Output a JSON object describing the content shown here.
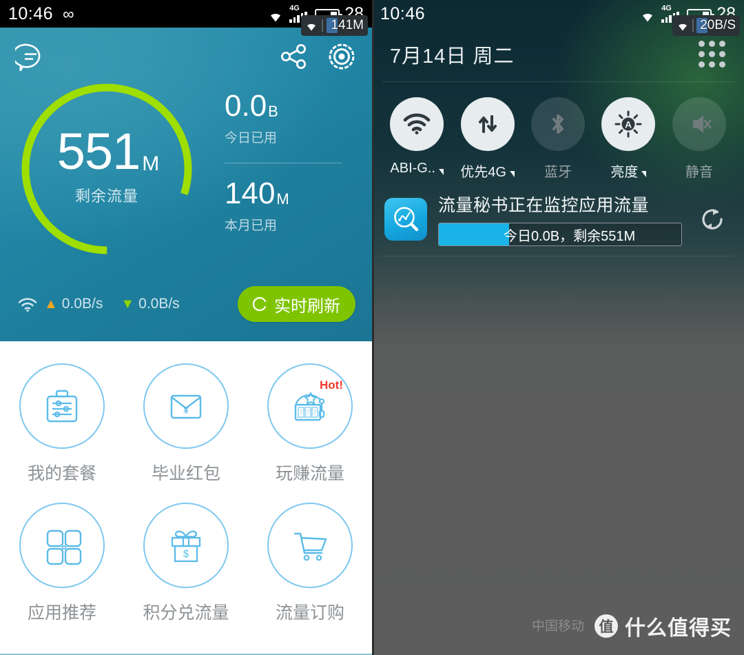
{
  "left": {
    "status_bar": {
      "time": "10:46",
      "infinity_glyph": "∞",
      "battery_percent": "28",
      "network_type": "4G",
      "overlay_badge": {
        "value": "141M"
      }
    },
    "hero": {
      "gauge": {
        "value": "551",
        "unit": "M",
        "label": "剩余流量",
        "percent": 80,
        "arc_color": "#9ede00",
        "track_color": "#5f6f72"
      },
      "stats": [
        {
          "value": "0.0",
          "unit": "B",
          "caption": "今日已用"
        },
        {
          "value": "140",
          "unit": "M",
          "caption": "本月已用"
        }
      ],
      "speeds": [
        {
          "direction": "up",
          "value": "0.0B/s",
          "color": "#f5a623"
        },
        {
          "direction": "down",
          "value": "0.0B/s",
          "color": "#8fd400"
        }
      ],
      "refresh_button": "实时刷新"
    },
    "grid": [
      {
        "label": "我的套餐",
        "icon": "briefcase-settings-icon",
        "badge": ""
      },
      {
        "label": "毕业红包",
        "icon": "envelope-yuan-icon",
        "badge": ""
      },
      {
        "label": "玩赚流量",
        "icon": "slot-machine-icon",
        "badge": "Hot!"
      },
      {
        "label": "应用推荐",
        "icon": "four-squares-icon",
        "badge": ""
      },
      {
        "label": "积分兑流量",
        "icon": "gift-box-dollar-icon",
        "badge": ""
      },
      {
        "label": "流量订购",
        "icon": "shopping-cart-icon",
        "badge": ""
      }
    ]
  },
  "right": {
    "status_bar": {
      "time": "10:46",
      "battery_percent": "28",
      "network_type": "4G",
      "overlay_badge": {
        "value": "20B/S"
      }
    },
    "date": "7月14日  周二",
    "quick_settings": [
      {
        "label": "ABI-G..",
        "icon": "wifi-icon",
        "enabled": true,
        "has_caret": true
      },
      {
        "label": "优先4G",
        "icon": "data-transfer-icon",
        "enabled": true,
        "has_caret": true
      },
      {
        "label": "蓝牙",
        "icon": "bluetooth-icon",
        "enabled": false,
        "has_caret": false
      },
      {
        "label": "亮度",
        "icon": "brightness-auto-icon",
        "enabled": true,
        "has_caret": true
      },
      {
        "label": "静音",
        "icon": "mute-icon",
        "enabled": false,
        "has_caret": false
      }
    ],
    "notification": {
      "title": "流量秘书正在监控应用流量",
      "progress_text": "今日0.0B，剩余551M",
      "progress_percent": 29,
      "action_icon": "refresh-icon"
    },
    "carrier": "中国移动",
    "watermark": {
      "logo": "值",
      "text": "什么值得买"
    }
  }
}
